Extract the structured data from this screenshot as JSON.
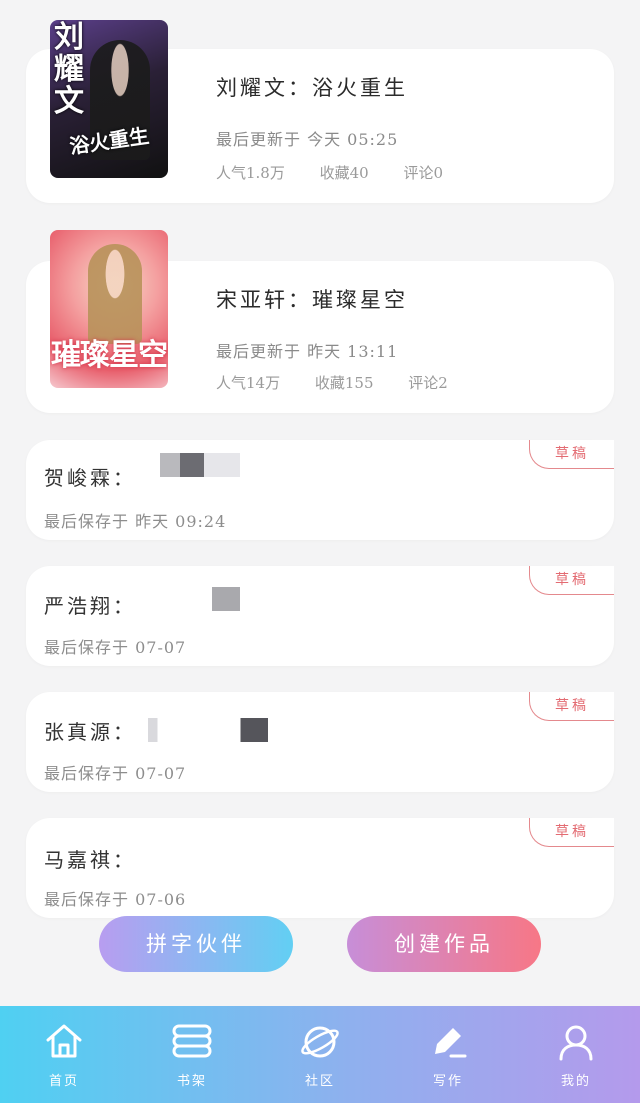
{
  "published": [
    {
      "cover_title": "刘耀文",
      "cover_subtitle": "浴火重生",
      "title": "刘耀文：浴火重生",
      "updated": "最后更新于  今天 05:25",
      "popularity": "人气1.8万",
      "favorites": "收藏40",
      "comments": "评论0"
    },
    {
      "cover_subtitle": "璀璨星空",
      "title": "宋亚轩：璀璨星空",
      "updated": "最后更新于  昨天  13:11",
      "popularity": "人气14万",
      "favorites": "收藏155",
      "comments": "评论2"
    }
  ],
  "drafts": [
    {
      "title": "贺峻霖：",
      "saved": "最后保存于  昨天  09:24",
      "badge": "草稿"
    },
    {
      "title": "严浩翔：",
      "saved": "最后保存于  07-07",
      "badge": "草稿"
    },
    {
      "title": "张真源：",
      "saved": "最后保存于  07-07",
      "badge": "草稿"
    },
    {
      "title": "马嘉祺：",
      "saved": "最后保存于  07-06",
      "badge": "草稿"
    }
  ],
  "buttons": {
    "partner": "拼字伙伴",
    "create": "创建作品"
  },
  "tabs": [
    {
      "label": "首页",
      "icon": "home-icon"
    },
    {
      "label": "书架",
      "icon": "bookshelf-icon"
    },
    {
      "label": "社区",
      "icon": "planet-icon"
    },
    {
      "label": "写作",
      "icon": "pen-icon"
    },
    {
      "label": "我的",
      "icon": "user-icon"
    }
  ],
  "colors": {
    "badge": "#e36b72",
    "tabbar_start": "#4fd0f2",
    "tabbar_end": "#b49aec"
  }
}
